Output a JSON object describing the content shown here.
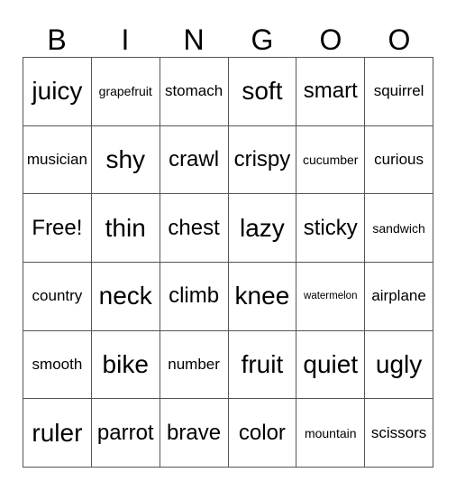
{
  "header": [
    "B",
    "I",
    "N",
    "G",
    "O",
    "O"
  ],
  "cells": [
    [
      "juicy",
      "grapefruit",
      "stomach",
      "soft",
      "smart",
      "squirrel"
    ],
    [
      "musician",
      "shy",
      "crawl",
      "crispy",
      "cucumber",
      "curious"
    ],
    [
      "Free!",
      "thin",
      "chest",
      "lazy",
      "sticky",
      "sandwich"
    ],
    [
      "country",
      "neck",
      "climb",
      "knee",
      "watermelon",
      "airplane"
    ],
    [
      "smooth",
      "bike",
      "number",
      "fruit",
      "quiet",
      "ugly"
    ],
    [
      "ruler",
      "parrot",
      "brave",
      "color",
      "mountain",
      "scissors"
    ]
  ]
}
